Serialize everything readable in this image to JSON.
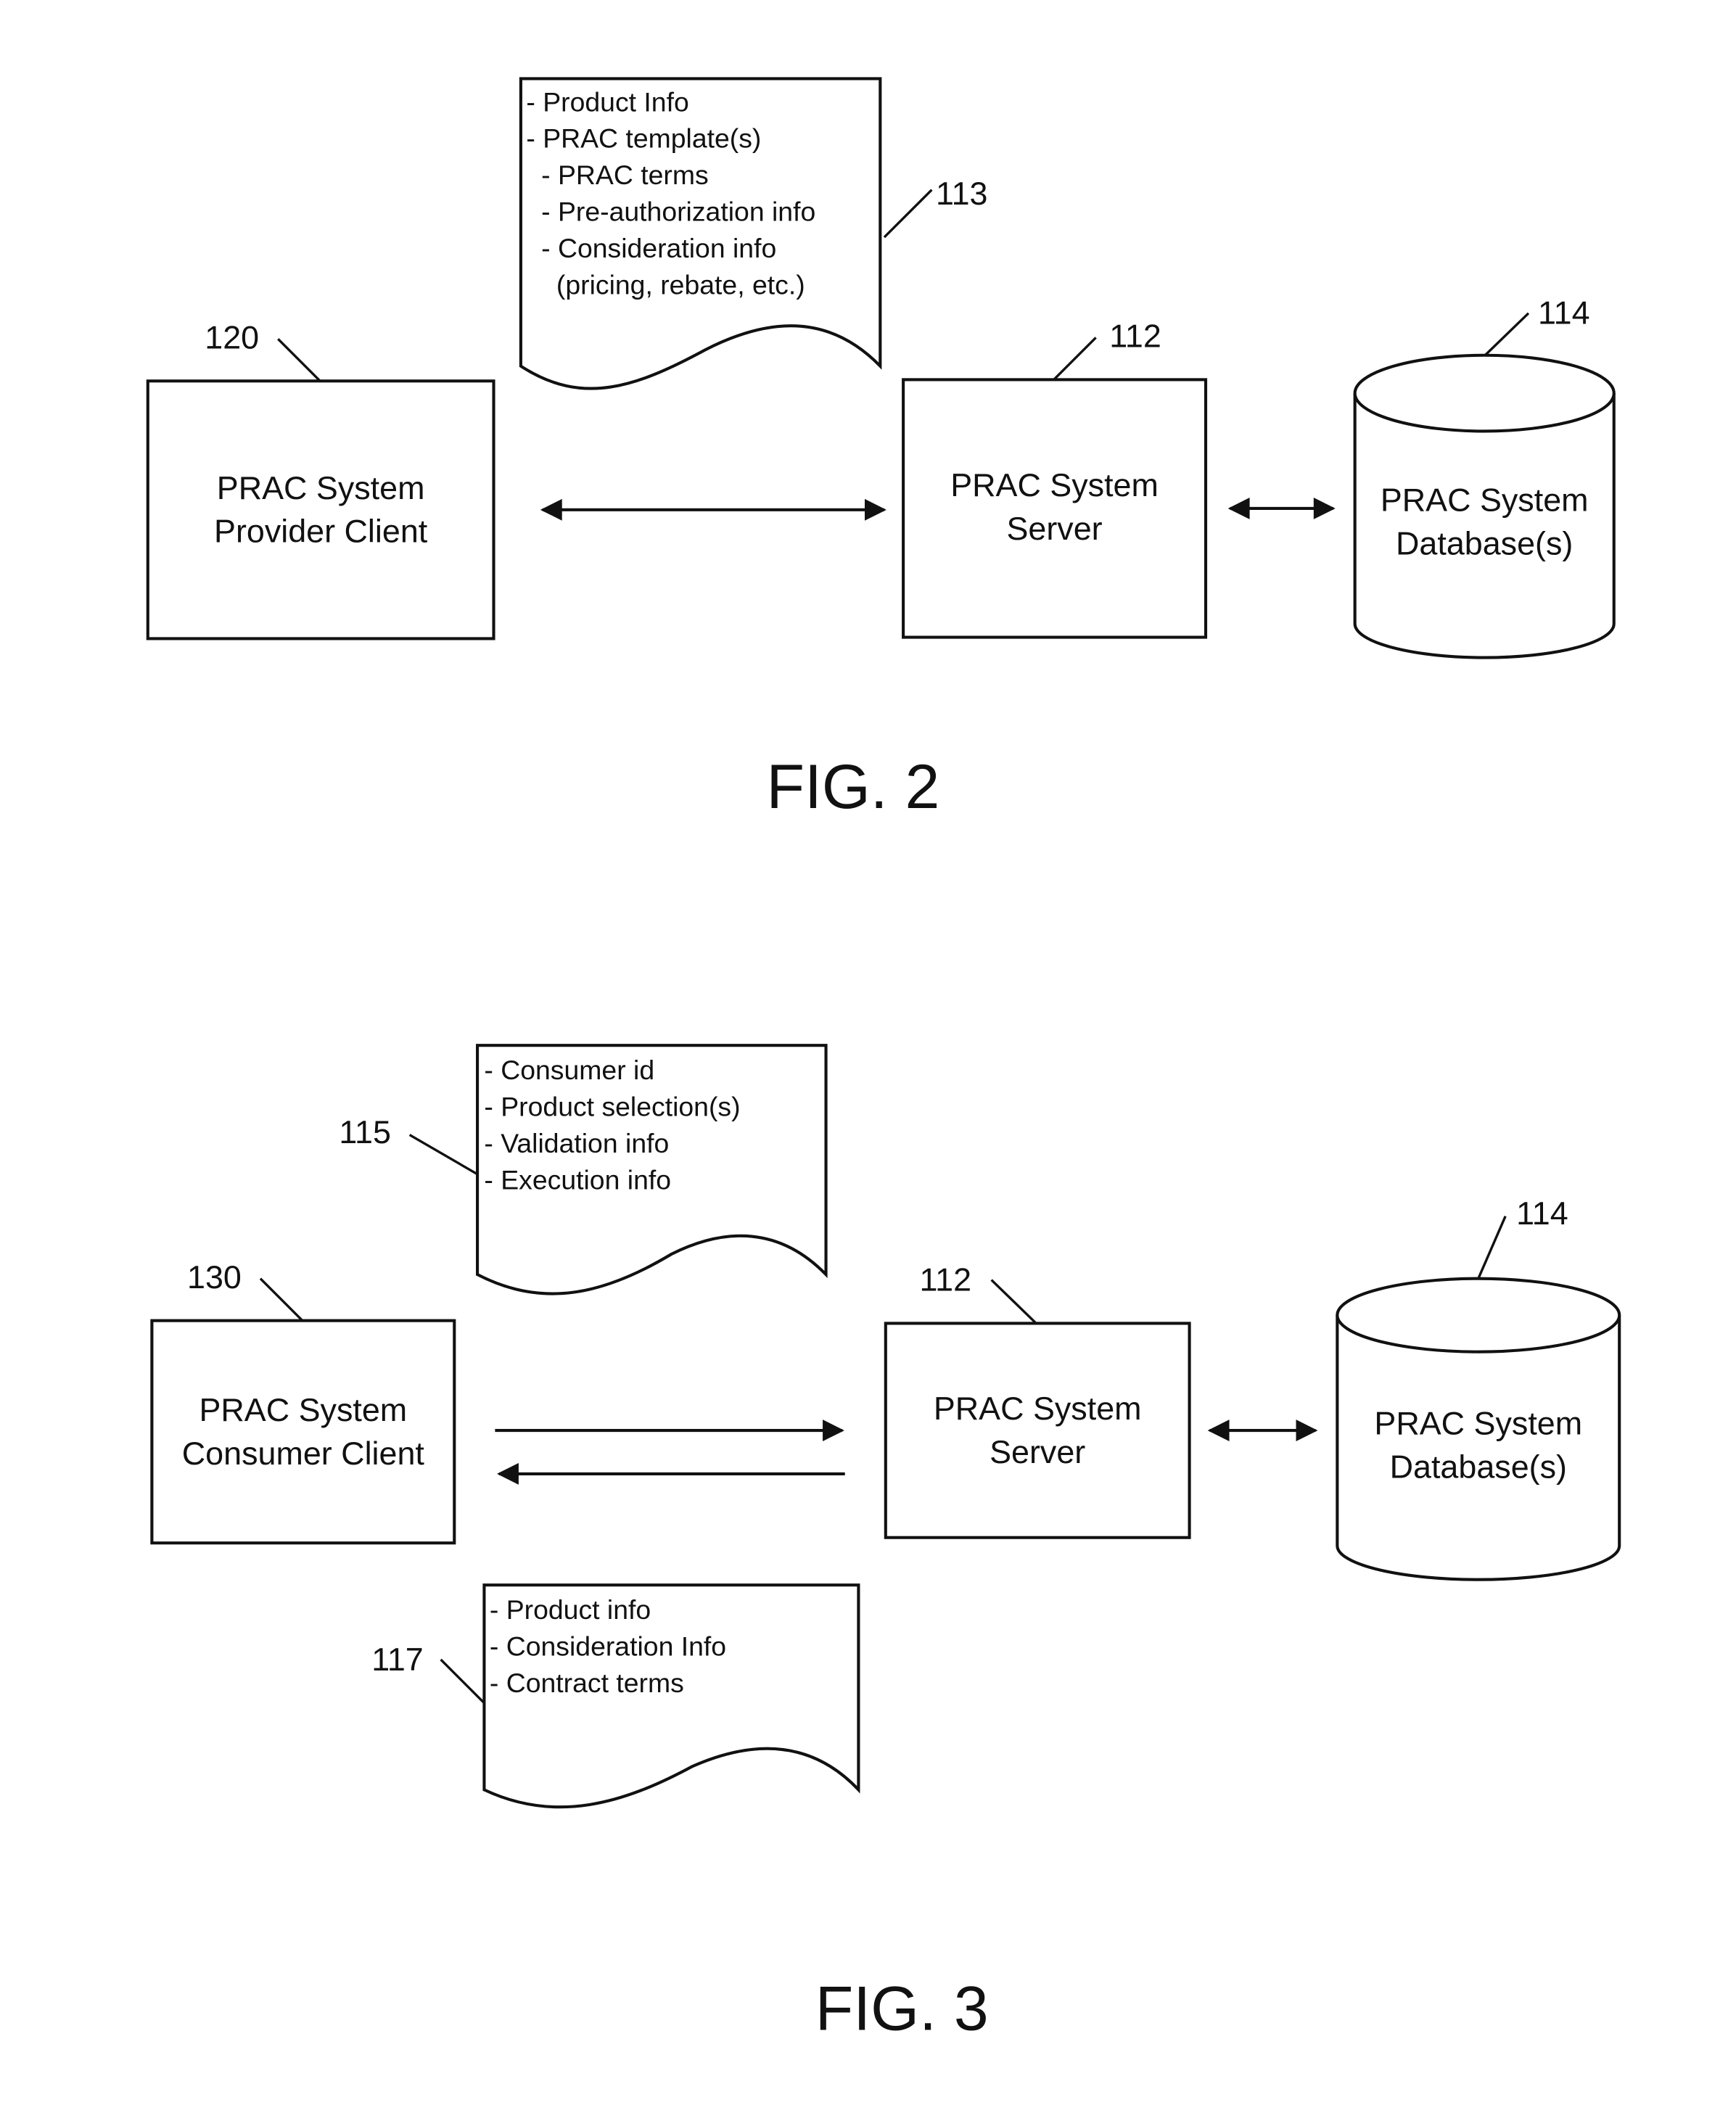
{
  "figures": [
    {
      "caption": "FIG. 2",
      "document": {
        "ref": "113",
        "lines": [
          "- Product Info",
          "- PRAC template(s)",
          "  - PRAC terms",
          "  - Pre-authorization info",
          "  - Consideration info",
          "    (pricing, rebate, etc.)"
        ]
      },
      "client": {
        "ref": "120",
        "line1": "PRAC System",
        "line2": "Provider Client"
      },
      "server": {
        "ref": "112",
        "line1": "PRAC System",
        "line2": "Server"
      },
      "database": {
        "ref": "114",
        "line1": "PRAC System",
        "line2": "Database(s)"
      },
      "connections": [
        {
          "from": "client",
          "to": "server",
          "type": "bidirectional"
        },
        {
          "from": "server",
          "to": "database",
          "type": "bidirectional"
        }
      ]
    },
    {
      "caption": "FIG. 3",
      "request_document": {
        "ref": "115",
        "lines": [
          "- Consumer id",
          "- Product selection(s)",
          "- Validation info",
          "- Execution info"
        ]
      },
      "response_document": {
        "ref": "117",
        "lines": [
          "- Product info",
          "- Consideration Info",
          "- Contract terms"
        ]
      },
      "client": {
        "ref": "130",
        "line1": "PRAC System",
        "line2": "Consumer Client"
      },
      "server": {
        "ref": "112",
        "line1": "PRAC System",
        "line2": "Server"
      },
      "database": {
        "ref": "114",
        "line1": "PRAC System",
        "line2": "Database(s)"
      },
      "connections": [
        {
          "from": "client",
          "to": "server",
          "type": "one-way"
        },
        {
          "from": "server",
          "to": "client",
          "type": "one-way"
        },
        {
          "from": "server",
          "to": "database",
          "type": "bidirectional"
        }
      ]
    }
  ]
}
